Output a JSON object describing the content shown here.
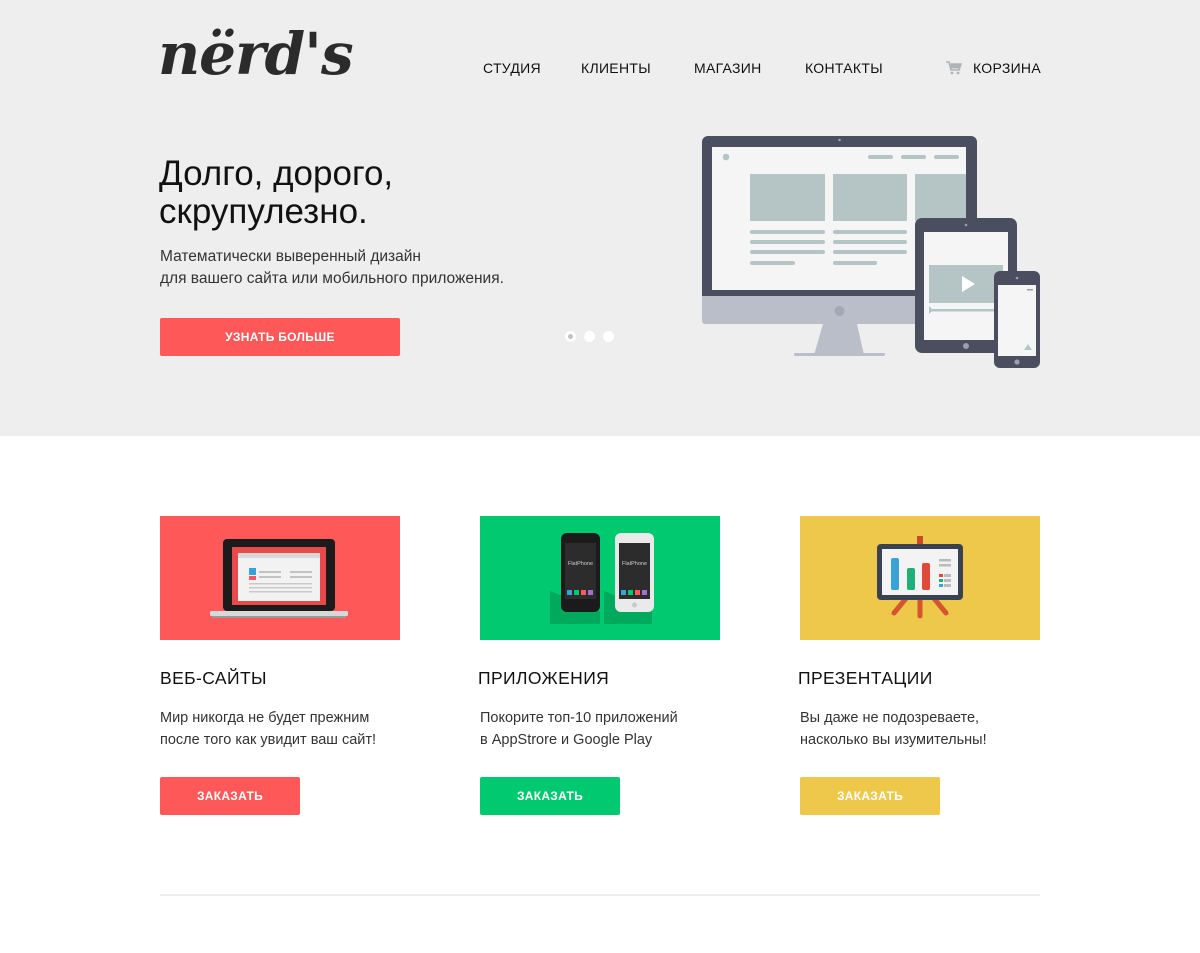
{
  "logo": {
    "text": "nërd's"
  },
  "nav": {
    "items": [
      {
        "label": "СТУДИЯ"
      },
      {
        "label": "КЛИЕНТЫ"
      },
      {
        "label": "МАГАЗИН"
      },
      {
        "label": "КОНТАКТЫ"
      }
    ],
    "cart": {
      "icon": "cart-icon",
      "label": "КОРЗИНА"
    }
  },
  "hero": {
    "title_line1": "Долго, дорого,",
    "title_line2": "скрупулезно.",
    "subtitle_line1": "Математически выверенный дизайн",
    "subtitle_line2": "для вашего сайта или мобильного приложения.",
    "button_label": "УЗНАТЬ БОЛЬШЕ",
    "slider": {
      "count": 3,
      "active": 1
    },
    "illustration": "devices-illustration"
  },
  "services": [
    {
      "title": "ВЕБ-САЙТЫ",
      "text_line1": "Мир никогда не будет прежним",
      "text_line2": "после того как увидит ваш сайт!",
      "button_label": "ЗАКАЗАТЬ",
      "color": "#fe5859",
      "image": "laptop-illustration"
    },
    {
      "title": "ПРИЛОЖЕНИЯ",
      "text_line1": "Покорите топ-10 приложений",
      "text_line2": "в AppStrore и Google Play",
      "button_label": "ЗАКАЗАТЬ",
      "color": "#00c96f",
      "image": "phones-illustration",
      "phone_label": "FlatPhone"
    },
    {
      "title": "ПРЕЗЕНТАЦИИ",
      "text_line1": "Вы даже не подозреваете,",
      "text_line2": "насколько вы изумительны!",
      "button_label": "ЗАКАЗАТЬ",
      "color": "#eec84a",
      "image": "presentation-board-illustration"
    }
  ],
  "colors": {
    "hero_bg": "#eeeeee",
    "accent_red": "#fe5859",
    "accent_green": "#00c96f",
    "accent_yellow": "#eec84a",
    "device_dark": "#4a4e5e",
    "device_light": "#b5c5c5"
  }
}
